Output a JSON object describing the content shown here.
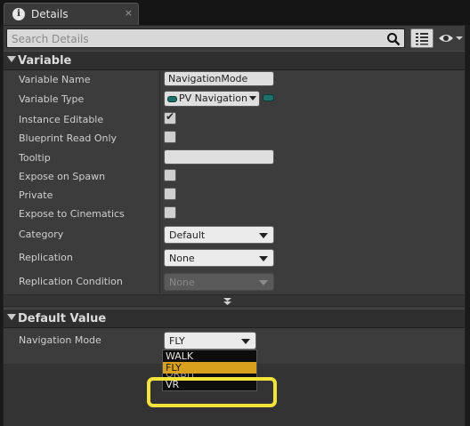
{
  "tab": {
    "icon": "info-icon",
    "title": "Details",
    "close_glyph": "×"
  },
  "search": {
    "placeholder": "Search Details",
    "value": ""
  },
  "sections": {
    "variable": {
      "title": "Variable"
    },
    "default_value": {
      "title": "Default Value"
    }
  },
  "properties": {
    "variable_name": {
      "label": "Variable Name",
      "value": "NavigationMode"
    },
    "variable_type": {
      "label": "Variable Type",
      "value": "PV Navigation Mode"
    },
    "instance_editable": {
      "label": "Instance Editable",
      "checked": true
    },
    "blueprint_read_only": {
      "label": "Blueprint Read Only",
      "checked": false
    },
    "tooltip": {
      "label": "Tooltip",
      "value": ""
    },
    "expose_on_spawn": {
      "label": "Expose on Spawn",
      "checked": false
    },
    "private": {
      "label": "Private",
      "checked": false
    },
    "expose_to_cinematics": {
      "label": "Expose to Cinematics",
      "checked": false
    },
    "category": {
      "label": "Category",
      "value": "Default"
    },
    "replication": {
      "label": "Replication",
      "value": "None"
    },
    "replication_condition": {
      "label": "Replication Condition",
      "value": "None"
    }
  },
  "default_value": {
    "navigation_mode": {
      "label": "Navigation Mode",
      "value": "FLY"
    }
  },
  "dropdown": {
    "options": [
      "WALK",
      "FLY",
      "ORBIT",
      "VR"
    ],
    "selected": "FLY"
  },
  "colors": {
    "panel_bg": "#3c3c3c",
    "selected_option": "#d9a01e",
    "highlight": "#f3e33a",
    "enum_pin": "#1f6f6a"
  }
}
